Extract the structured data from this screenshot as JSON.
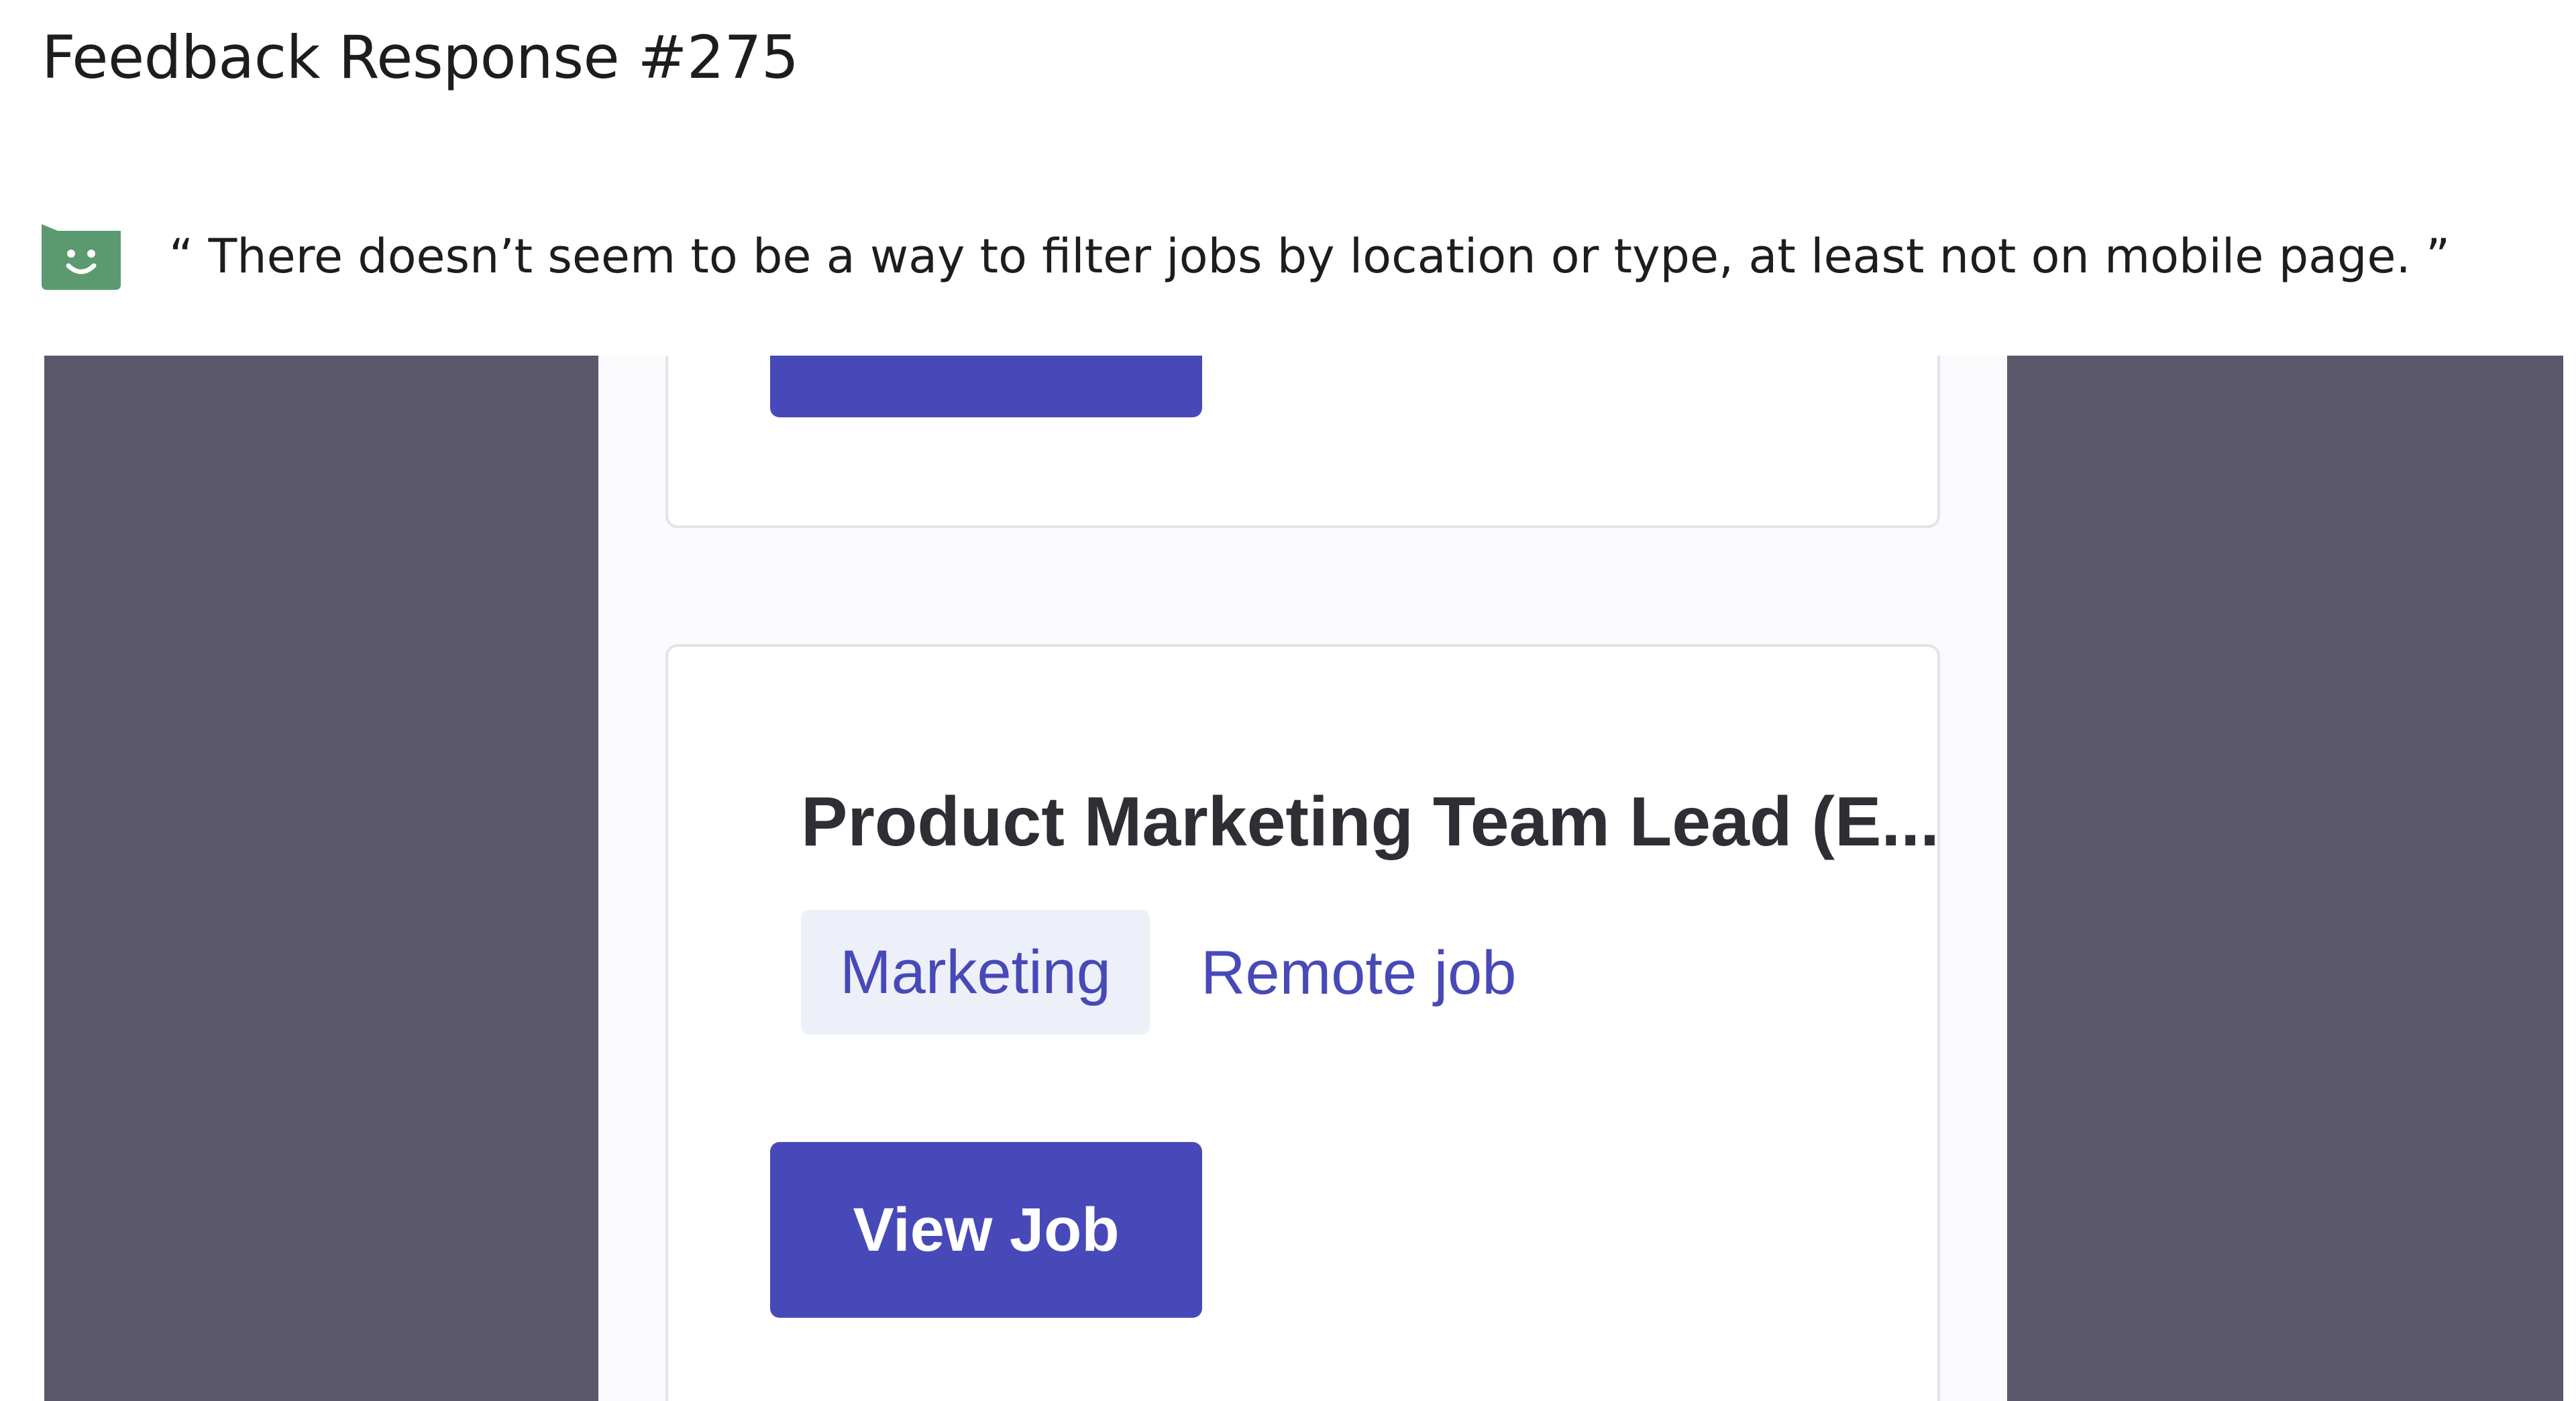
{
  "header": {
    "title": "Feedback Response #275"
  },
  "feedback": {
    "sentiment_icon": "smiley-face-icon",
    "quote": "“ There doesn’t seem to be a way to filter jobs by location or type, at least not on mobile page. ”",
    "icon_color": "#5b9a6e"
  },
  "screenshot": {
    "job_card": {
      "title": "Product Marketing Team Lead (E...",
      "tags": [
        "Marketing",
        "Remote job"
      ],
      "button_label": "View Job"
    },
    "colors": {
      "backdrop": "#5b586b",
      "accent": "#4849b8",
      "tag_bg": "#eef0f9"
    }
  }
}
